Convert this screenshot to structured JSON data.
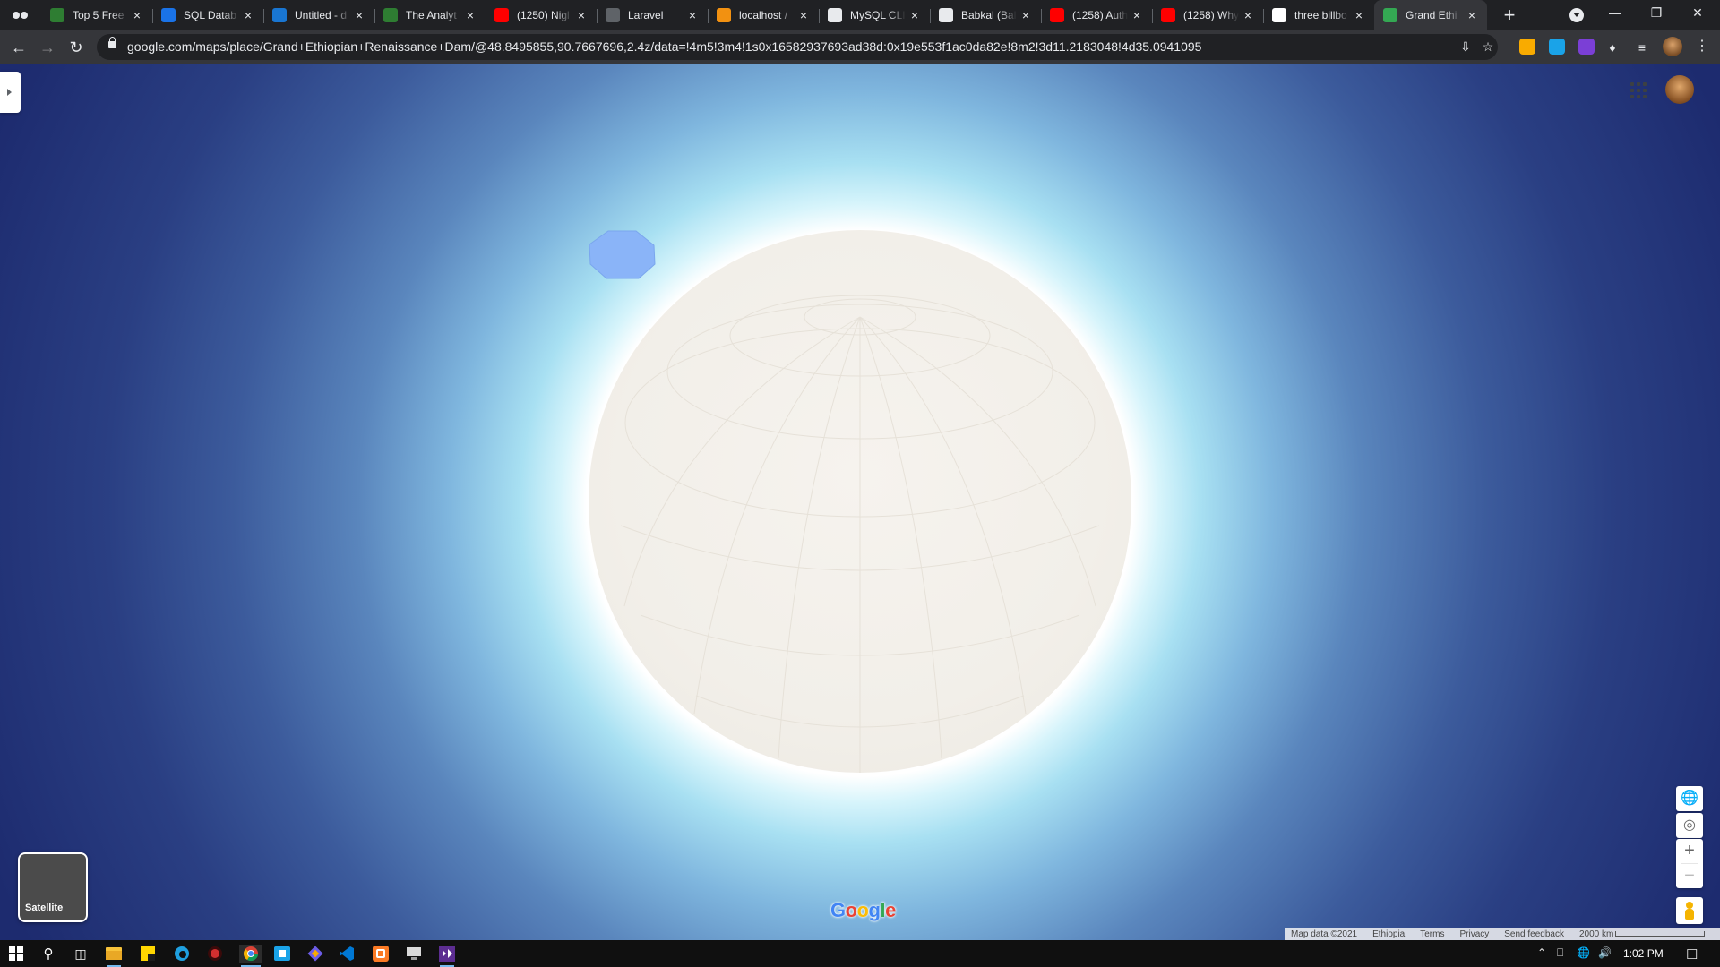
{
  "browser": {
    "tabs": [
      {
        "title": "Top 5 Free",
        "icon": "leaf-icon",
        "color": "#2e7d32"
      },
      {
        "title": "SQL Datab",
        "icon": "database-icon",
        "color": "#1a73e8"
      },
      {
        "title": "Untitled - d",
        "icon": "share-icon",
        "color": "#1976d2"
      },
      {
        "title": "The Analyt",
        "icon": "leaf-icon",
        "color": "#2e7d32"
      },
      {
        "title": "(1250) Nigl",
        "icon": "youtube-icon",
        "color": "#ff0000"
      },
      {
        "title": "Laravel",
        "icon": "globe-icon",
        "color": "#5f6368"
      },
      {
        "title": "localhost /",
        "icon": "phpmyadmin-icon",
        "color": "#f29111"
      },
      {
        "title": "MySQL CLI",
        "icon": "github-icon",
        "color": "#e8eaed"
      },
      {
        "title": "Babkal (Bal",
        "icon": "github-icon",
        "color": "#e8eaed"
      },
      {
        "title": "(1258) Auth",
        "icon": "youtube-icon",
        "color": "#ff0000"
      },
      {
        "title": "(1258) Why",
        "icon": "youtube-icon",
        "color": "#ff0000"
      },
      {
        "title": "three billbo",
        "icon": "google-icon",
        "color": "#ffffff"
      },
      {
        "title": "Grand Ethi",
        "icon": "maps-pin-icon",
        "color": "#34a853",
        "active": true
      }
    ],
    "url": "google.com/maps/place/Grand+Ethiopian+Renaissance+Dam/@48.8495855,90.7667696,2.4z/data=!4m5!3m4!1s0x16582937693ad38d:0x19e553f1ac0da82e!8m2!3d11.2183048!4d35.0941095"
  },
  "map": {
    "layer_button_label": "Satellite",
    "logo_text": "Google",
    "attribution": {
      "map_data": "Map data ©2021",
      "country": "Ethiopia",
      "terms": "Terms",
      "privacy": "Privacy",
      "feedback": "Send feedback",
      "scale": "2000 km"
    },
    "colors": {
      "space_dark": "#1d2b6f",
      "atmosphere": "#a8e0f2",
      "land": "#f2efe9",
      "water": "#8ab4f8"
    }
  },
  "taskbar": {
    "time": "1:02 PM"
  }
}
